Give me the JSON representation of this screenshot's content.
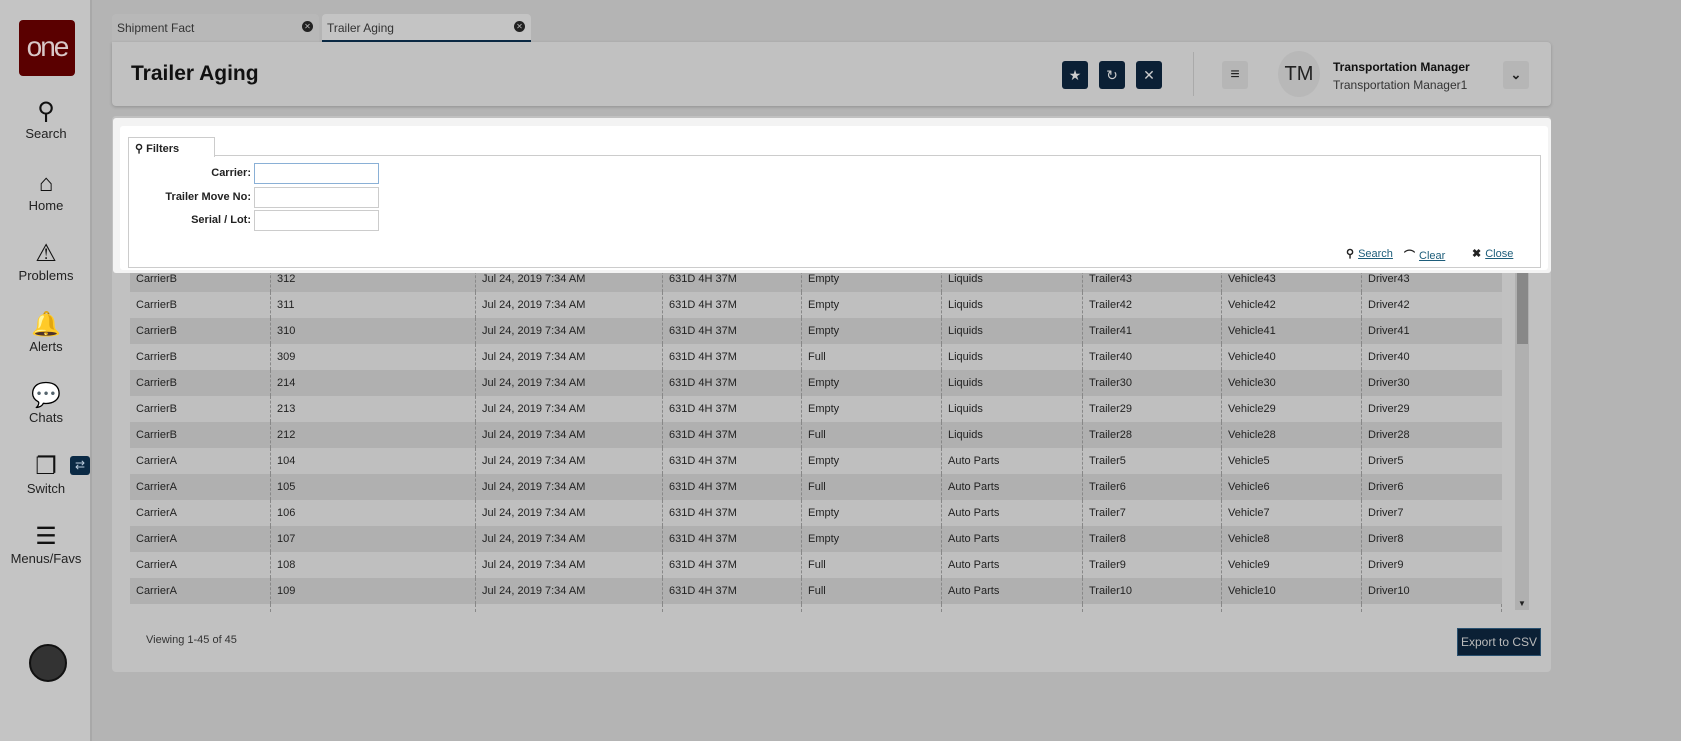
{
  "sidebar": {
    "logo": "one",
    "items": [
      {
        "label": "Search",
        "icon": "search-icon"
      },
      {
        "label": "Home",
        "icon": "home-icon"
      },
      {
        "label": "Problems",
        "icon": "warning-icon"
      },
      {
        "label": "Alerts",
        "icon": "bell-icon"
      },
      {
        "label": "Chats",
        "icon": "chat-icon"
      },
      {
        "label": "Switch",
        "icon": "switch-icon"
      },
      {
        "label": "Menus/Favs",
        "icon": "menu-icon"
      }
    ]
  },
  "tabs": [
    {
      "label": "Shipment Fact"
    },
    {
      "label": "Trailer Aging"
    }
  ],
  "header": {
    "title": "Trailer Aging",
    "user_initials": "TM",
    "user_name": "Transportation Manager",
    "user_role": "Transportation Manager1"
  },
  "filters": {
    "tab_label": "Filters",
    "fields": [
      {
        "label": "Carrier:",
        "value": ""
      },
      {
        "label": "Trailer Move No:",
        "value": ""
      },
      {
        "label": "Serial / Lot:",
        "value": ""
      }
    ],
    "search": "Search",
    "clear": "Clear",
    "close": "Close"
  },
  "table": {
    "rows": [
      [
        "CarrierB",
        "312",
        "Jul 24, 2019 7:34 AM",
        "631D 4H 37M",
        "Empty",
        "Liquids",
        "Trailer43",
        "Vehicle43",
        "Driver43"
      ],
      [
        "CarrierB",
        "311",
        "Jul 24, 2019 7:34 AM",
        "631D 4H 37M",
        "Empty",
        "Liquids",
        "Trailer42",
        "Vehicle42",
        "Driver42"
      ],
      [
        "CarrierB",
        "310",
        "Jul 24, 2019 7:34 AM",
        "631D 4H 37M",
        "Empty",
        "Liquids",
        "Trailer41",
        "Vehicle41",
        "Driver41"
      ],
      [
        "CarrierB",
        "309",
        "Jul 24, 2019 7:34 AM",
        "631D 4H 37M",
        "Full",
        "Liquids",
        "Trailer40",
        "Vehicle40",
        "Driver40"
      ],
      [
        "CarrierB",
        "214",
        "Jul 24, 2019 7:34 AM",
        "631D 4H 37M",
        "Empty",
        "Liquids",
        "Trailer30",
        "Vehicle30",
        "Driver30"
      ],
      [
        "CarrierB",
        "213",
        "Jul 24, 2019 7:34 AM",
        "631D 4H 37M",
        "Empty",
        "Liquids",
        "Trailer29",
        "Vehicle29",
        "Driver29"
      ],
      [
        "CarrierB",
        "212",
        "Jul 24, 2019 7:34 AM",
        "631D 4H 37M",
        "Full",
        "Liquids",
        "Trailer28",
        "Vehicle28",
        "Driver28"
      ],
      [
        "CarrierA",
        "104",
        "Jul 24, 2019 7:34 AM",
        "631D 4H 37M",
        "Empty",
        "Auto Parts",
        "Trailer5",
        "Vehicle5",
        "Driver5"
      ],
      [
        "CarrierA",
        "105",
        "Jul 24, 2019 7:34 AM",
        "631D 4H 37M",
        "Full",
        "Auto Parts",
        "Trailer6",
        "Vehicle6",
        "Driver6"
      ],
      [
        "CarrierA",
        "106",
        "Jul 24, 2019 7:34 AM",
        "631D 4H 37M",
        "Empty",
        "Auto Parts",
        "Trailer7",
        "Vehicle7",
        "Driver7"
      ],
      [
        "CarrierA",
        "107",
        "Jul 24, 2019 7:34 AM",
        "631D 4H 37M",
        "Empty",
        "Auto Parts",
        "Trailer8",
        "Vehicle8",
        "Driver8"
      ],
      [
        "CarrierA",
        "108",
        "Jul 24, 2019 7:34 AM",
        "631D 4H 37M",
        "Full",
        "Auto Parts",
        "Trailer9",
        "Vehicle9",
        "Driver9"
      ],
      [
        "CarrierA",
        "109",
        "Jul 24, 2019 7:34 AM",
        "631D 4H 37M",
        "Full",
        "Auto Parts",
        "Trailer10",
        "Vehicle10",
        "Driver10"
      ]
    ]
  },
  "footer": {
    "viewing": "Viewing 1-45 of 45",
    "export": "Export to CSV"
  },
  "colors": {
    "brand": "#5a0000",
    "navy": "#0b2035",
    "link": "#1d5d7a"
  }
}
